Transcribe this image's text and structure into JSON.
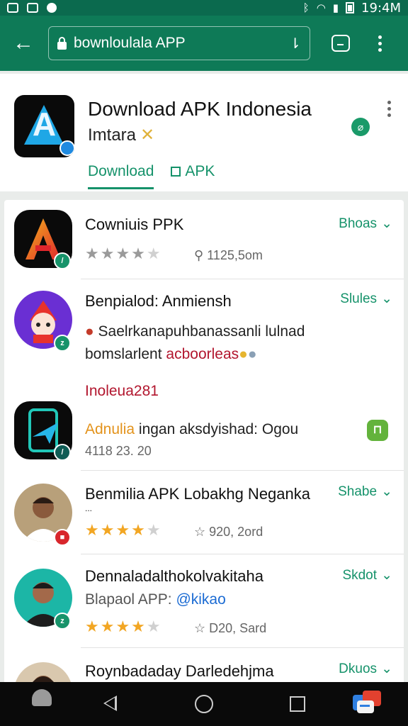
{
  "status_bar": {
    "time": "19:4M"
  },
  "app_bar": {
    "url": "bownloulala APP"
  },
  "header": {
    "title": "Download APK Indonesia",
    "subtitle": "Imtara",
    "tabs": [
      {
        "label": "Download",
        "active": true
      },
      {
        "label": "APK",
        "active": false
      }
    ]
  },
  "list": [
    {
      "title": "Cowniuis PPK",
      "action": "Bhoas",
      "rating": 3.5,
      "meta": "1125,5om"
    },
    {
      "title": "Benpialod: Anmiensh",
      "action": "Slules",
      "line1": "Saelrkanapuhbanassanli lulnad",
      "line2_a": "bomslarlent",
      "line2_b": "acboorleas",
      "tag": "Inoleua281"
    },
    {
      "title_a": "Adnulia",
      "title_b": "ingan aksdyishad: Ogou",
      "sub": "4118 23. 20"
    },
    {
      "title": "Benmilia APK Lobakhg Neganka",
      "sub": "...",
      "action": "Shabe",
      "rating": 3.5,
      "meta": "920, 2ord"
    },
    {
      "title": "Dennaladalthokolvakitaha",
      "sub_a": "Blapaol APP:",
      "sub_b": "@kikao",
      "action": "Skdot",
      "rating": 3.5,
      "meta": "D20, Sard"
    },
    {
      "title": "Roynbadaday Darledehjma",
      "action": "Dkuos"
    }
  ],
  "colors": {
    "appbar": "#0e7a57",
    "accent": "#15926a",
    "star": "#f2a623"
  }
}
